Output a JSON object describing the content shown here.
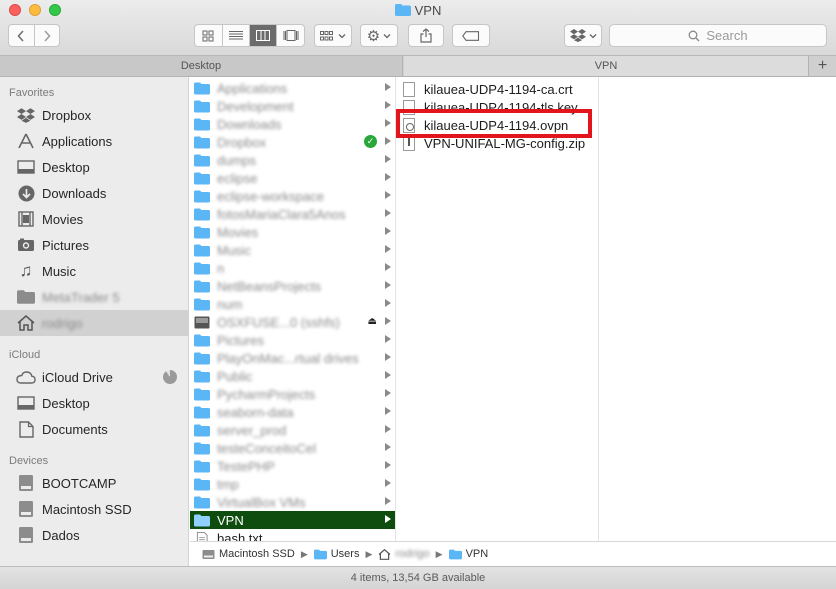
{
  "window": {
    "title": "VPN"
  },
  "toolbar": {
    "search_placeholder": "Search",
    "back_icon": "chevron-left-icon",
    "forward_icon": "chevron-right-icon"
  },
  "tabs": [
    {
      "label": "Desktop"
    },
    {
      "label": "VPN"
    }
  ],
  "sidebar": {
    "favorites_header": "Favorites",
    "favorites": [
      {
        "label": "Dropbox",
        "icon": "dropbox-icon"
      },
      {
        "label": "Applications",
        "icon": "applications-icon"
      },
      {
        "label": "Desktop",
        "icon": "desktop-icon"
      },
      {
        "label": "Downloads",
        "icon": "downloads-icon"
      },
      {
        "label": "Movies",
        "icon": "movies-icon"
      },
      {
        "label": "Pictures",
        "icon": "pictures-icon"
      },
      {
        "label": "Music",
        "icon": "music-icon"
      },
      {
        "label": "MetaTrader 5",
        "icon": "folder-icon"
      },
      {
        "label": "rodrigo",
        "icon": "home-icon"
      }
    ],
    "icloud_header": "iCloud",
    "icloud": [
      {
        "label": "iCloud Drive",
        "icon": "cloud-icon"
      },
      {
        "label": "Desktop",
        "icon": "desktop-icon"
      },
      {
        "label": "Documents",
        "icon": "documents-icon"
      }
    ],
    "devices_header": "Devices",
    "devices": [
      {
        "label": "BOOTCAMP",
        "icon": "disk-icon"
      },
      {
        "label": "Macintosh SSD",
        "icon": "disk-icon"
      },
      {
        "label": "Dados",
        "icon": "disk-icon"
      }
    ]
  },
  "column1": [
    {
      "label": "Applications"
    },
    {
      "label": "Development"
    },
    {
      "label": "Downloads"
    },
    {
      "label": "Dropbox"
    },
    {
      "label": "dumps"
    },
    {
      "label": "eclipse"
    },
    {
      "label": "eclipse-workspace"
    },
    {
      "label": "fotosMariaClara5Anos"
    },
    {
      "label": "Movies"
    },
    {
      "label": "Music"
    },
    {
      "label": "n"
    },
    {
      "label": "NetBeansProjects"
    },
    {
      "label": "num"
    },
    {
      "label": "OSXFUSE...0 (sshfs)"
    },
    {
      "label": "Pictures"
    },
    {
      "label": "PlayOnMac...rtual drives"
    },
    {
      "label": "Public"
    },
    {
      "label": "PycharmProjects"
    },
    {
      "label": "seaborn-data"
    },
    {
      "label": "server_prod"
    },
    {
      "label": "testeConceitoCel"
    },
    {
      "label": "TestePHP"
    },
    {
      "label": "tmp"
    },
    {
      "label": "VirtualBox VMs"
    },
    {
      "label": "VPN"
    },
    {
      "label": "bash.txt"
    }
  ],
  "column2": [
    {
      "label": "kilauea-UDP4-1194-ca.crt"
    },
    {
      "label": "kilauea-UDP4-1194-tls.key"
    },
    {
      "label": "kilauea-UDP4-1194.ovpn"
    },
    {
      "label": "VPN-UNIFAL-MG-config.zip"
    }
  ],
  "pathbar": {
    "disk": "Macintosh SSD",
    "users": "Users",
    "home": "rodrigo",
    "folder": "VPN"
  },
  "status": {
    "text": "4 items, 13,54 GB available"
  },
  "colors": {
    "selection": "#0e4d0e",
    "highlight": "#e3141c",
    "folder": "#5bb6f5"
  }
}
